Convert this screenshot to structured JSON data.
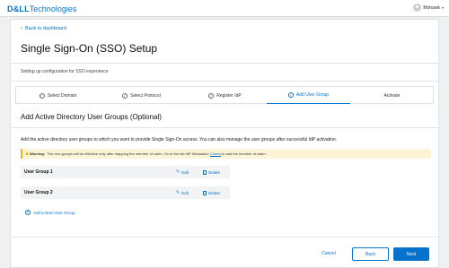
{
  "header": {
    "logo_dell": "D&LL",
    "logo_tech": "Technologies",
    "user_name": "Mohawk",
    "user_chevron": "▾"
  },
  "nav": {
    "back_label": "Back to dashboard"
  },
  "page": {
    "title": "Single Sign-On (SSO) Setup",
    "subtitle": "Setting up configuration for SSO experience"
  },
  "stepper": {
    "steps": [
      {
        "label": "Select Domain",
        "state": "complete"
      },
      {
        "label": "Select Protocol",
        "state": "complete"
      },
      {
        "label": "Register IdP",
        "state": "complete"
      },
      {
        "label": "Add User Group",
        "state": "active"
      },
      {
        "label": "Activate",
        "state": "pending"
      }
    ]
  },
  "section": {
    "title": "Add Active Directory User Groups (Optional)",
    "description": "Add the active directory user groups to which you want to provide Single Sign-On access.  You can also manage the user groups after successful IdP activation."
  },
  "warning": {
    "label": "Warning:",
    "text_before": "The new groups will be effective only after mapping the member of claim.  Go to the tab IdP Metadata>",
    "link": "Claims",
    "text_after": "to add the member of claim."
  },
  "groups": [
    {
      "name": "User Group 1",
      "edit_label": "Edit",
      "delete_label": "Delete"
    },
    {
      "name": "User Group 2",
      "edit_label": "Edit",
      "delete_label": "Delete"
    }
  ],
  "add_group_label": "Add a New User Group",
  "footer": {
    "cancel_label": "Cancel",
    "back_label": "Back",
    "next_label": "Next"
  },
  "colors": {
    "accent": "#0672cb",
    "warning_bg": "#fdf4d6",
    "warning_border": "#f2b01e"
  }
}
